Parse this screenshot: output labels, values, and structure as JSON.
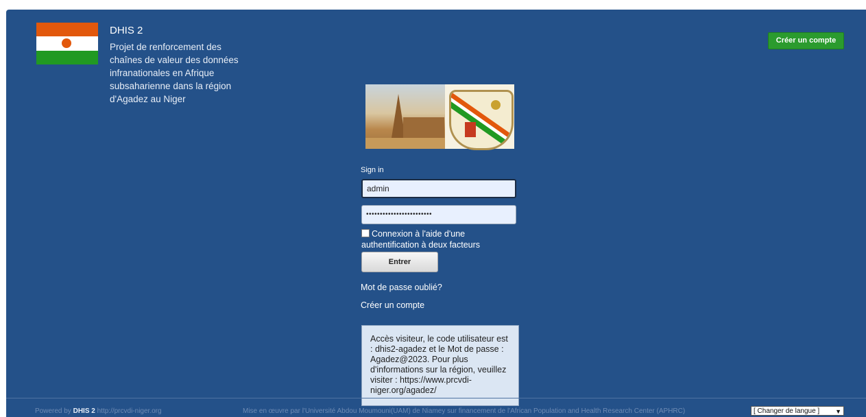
{
  "header": {
    "app_title": "DHIS 2",
    "description": "Projet de renforcement des chaînes de valeur des données infranationales en Afrique subsaharienne dans la région d'Agadez au Niger",
    "create_account_button": "Créer un compte"
  },
  "login": {
    "signin_label": "Sign in",
    "username_value": "admin",
    "password_value": "••••••••••••••••••••••••",
    "two_factor_label": "Connexion à l'aide d'une authentification à deux facteurs",
    "submit_label": "Entrer",
    "forgot_password": "Mot de passe oublié?",
    "create_account_link": "Créer un compte"
  },
  "notice": "Accès visiteur, le code utilisateur est : dhis2-agadez et le Mot de passe : Agadez@2023. Pour plus d'informations sur la région, veuillez visiter : https://www.prcvdi-niger.org/agadez/",
  "footer": {
    "powered_prefix": "Powered by",
    "powered_brand": "DHIS 2",
    "powered_url": "http://prcvdi-niger.org",
    "implementation": "Mise en œuvre par l'Université Abdou Moumouni(UAM) de Niamey sur financement de l'African Population and Health Research Center (APHRC)",
    "language_select": "[ Changer de langue ]"
  },
  "colors": {
    "panel_background": "#245189",
    "create_button": "#2b9b2e",
    "notice_background": "#dbe6f3"
  }
}
